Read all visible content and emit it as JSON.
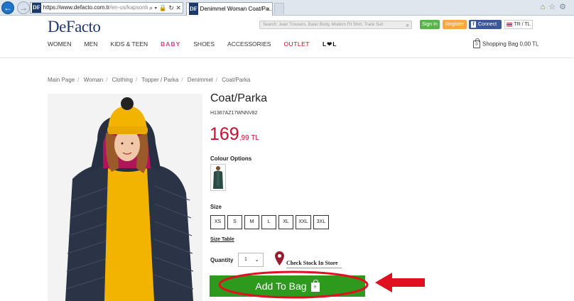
{
  "browser": {
    "favicon_text": "DF",
    "url_main": "https://www.defacto.com.tr",
    "url_rest": "/en-us/kapsonlu-sisme",
    "tab_title": "Denimmel Woman Coat/Pa...",
    "tab_close": "×"
  },
  "header": {
    "logo": "DeFacto",
    "search_placeholder": "Search: Jean Trousers, Basic Body, Modern Fit Shirt, Track Suit",
    "sign_in": "Sign In",
    "register": "Register",
    "facebook": "Connect",
    "language": "TR / TL"
  },
  "menu": {
    "items": [
      "WOMEN",
      "MEN",
      "KIDS & TEEN",
      "BABY",
      "SHOES",
      "ACCESSORIES",
      "OUTLET",
      "L❤L"
    ],
    "bag_count": "0",
    "bag_label": "Shopping Bag 0,00 TL"
  },
  "breadcrumb": [
    "Main Page",
    "Woman",
    "Clothing",
    "Topper / Parka",
    "Denimmel",
    "Coat/Parka"
  ],
  "product": {
    "title": "Coat/Parka",
    "code": "H1367AZ17WNNV82",
    "price_main": "169",
    "price_fraction": ",99 TL",
    "colour_label": "Colour Options",
    "size_label": "Size",
    "sizes": [
      "XS",
      "S",
      "M",
      "L",
      "XL",
      "XXL",
      "3XL"
    ],
    "size_table": "Size Table",
    "quantity_label": "Quantity",
    "quantity_value": "1",
    "check_stock": "Check Stock In Store",
    "add_to_bag": "Add To Bag",
    "bag_plus": "+"
  },
  "colors": {
    "brand_blue": "#233a70",
    "price_red": "#c8102e",
    "add_green": "#2d9a1e",
    "annotation_red": "#e01020"
  }
}
